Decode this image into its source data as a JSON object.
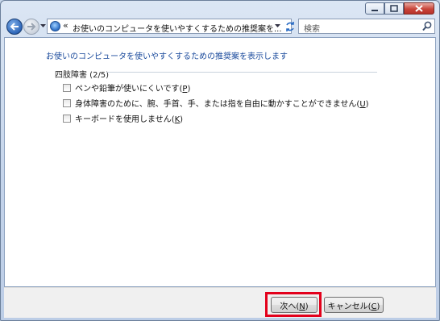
{
  "window": {
    "caption_buttons": [
      "minimize-icon",
      "maximize-icon",
      "close-icon"
    ]
  },
  "nav": {
    "address_separator": "«",
    "address_text": "お使いのコンピュータを使いやすくするための推奨案を...",
    "search_placeholder": "検索"
  },
  "content": {
    "instruction": "お使いのコンピュータを使いやすくするための推奨案を表示します",
    "group_label": "四肢障害 (2/5)",
    "options": [
      {
        "text": "ペンや鉛筆が使いにくいです",
        "mnemonic": "P",
        "checked": false
      },
      {
        "text": "身体障害のために、腕、手首、手、または指を自由に動かすことができません",
        "mnemonic": "U",
        "checked": false
      },
      {
        "text": "キーボードを使用しません",
        "mnemonic": "K",
        "checked": false
      }
    ]
  },
  "footer": {
    "next": {
      "text": "次へ",
      "mnemonic": "N"
    },
    "cancel": {
      "text": "キャンセル",
      "mnemonic": "C"
    }
  },
  "colors": {
    "highlight": "#e3001b",
    "instruction": "#1a4a9c"
  }
}
